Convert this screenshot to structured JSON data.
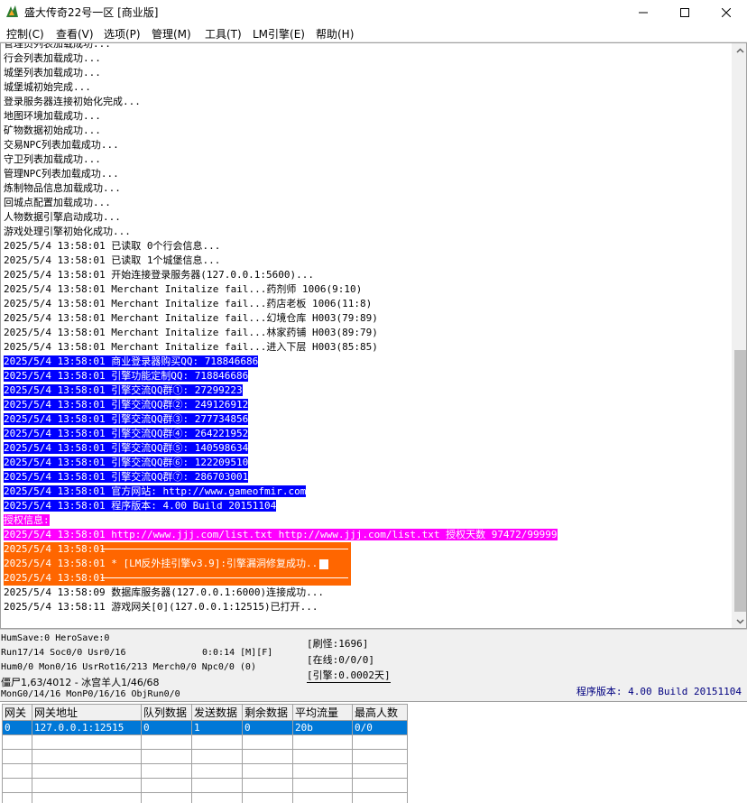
{
  "window": {
    "title": "盛大传奇22号一区 [商业版]",
    "controls": {
      "minimize": "minimize-icon",
      "maximize": "maximize-icon",
      "close": "close-icon"
    }
  },
  "menu": [
    "控制(C)",
    "查看(V)",
    "选项(P)",
    "管理(M)",
    "工具(T)",
    "LM引擎(E)",
    "帮助(H)"
  ],
  "log": [
    "管理员列表加载成功...",
    "行会列表加载成功...",
    "城堡列表加载成功...",
    "城堡城初始完成...",
    "登录服务器连接初始化完成...",
    "地图环境加载成功...",
    "矿物数据初始成功...",
    "交易NPC列表加载成功...",
    "守卫列表加载成功...",
    "管理NPC列表加载成功...",
    "炼制物品信息加载成功...",
    "回城点配置加载成功...",
    "人物数据引擎启动成功...",
    "游戏处理引擎初始化成功...",
    "2025/5/4 13:58:01 已读取 0个行会信息...",
    "2025/5/4 13:58:01 已读取 1个城堡信息...",
    "2025/5/4 13:58:01 开始连接登录服务器(127.0.0.1:5600)...",
    "2025/5/4 13:58:01 Merchant Initalize fail...药剂师 1006(9:10)",
    "2025/5/4 13:58:01 Merchant Initalize fail...药店老板 1006(11:8)",
    "2025/5/4 13:58:01 Merchant Initalize fail...幻境仓库 H003(79:89)",
    "2025/5/4 13:58:01 Merchant Initalize fail...林家药铺 H003(89:79)",
    "2025/5/4 13:58:01 Merchant Initalize fail...进入下层 H003(85:85)",
    "2025/5/4 13:58:01 商业登录器购买QQ: 718846686",
    "2025/5/4 13:58:01 引擎功能定制QQ: 718846686",
    "2025/5/4 13:58:01 引擎交流QQ群①: 27299223",
    "2025/5/4 13:58:01 引擎交流QQ群②: 249126912",
    "2025/5/4 13:58:01 引擎交流QQ群③: 277734856",
    "2025/5/4 13:58:01 引擎交流QQ群④: 264221952",
    "2025/5/4 13:58:01 引擎交流QQ群⑤: 140598634",
    "2025/5/4 13:58:01 引擎交流QQ群⑥: 122209510",
    "2025/5/4 13:58:01 引擎交流QQ群⑦: 286703001",
    "2025/5/4 13:58:01 官方网站: http://www.gameofmir.com",
    "2025/5/4 13:58:01 程序版本: 4.00 Build 20151104",
    "授权信息:",
    "2025/5/4 13:58:01 http://www.jjj.com/list.txt http://www.jjj.com/list.txt 授权天数 97472/99999",
    "2025/5/4 13:58:01",
    "2025/5/4 13:58:01 * [LM反外挂引擎v3.9]:引擎漏洞修复成功...",
    "2025/5/4 13:58:01",
    "2025/5/4 13:58:09 数据库服务器(127.0.0.1:6000)连接成功...",
    "2025/5/4 13:58:11 游戏网关[0](127.0.0.1:12515)已打开..."
  ],
  "status": {
    "line1": "HumSave:0 HeroSave:0",
    "line2": "Run17/14 Soc0/0 Usr0/16",
    "line2b": "0:0:14 [M][F]",
    "line3": "Hum0/0 Mon0/16 UsrRot16/213 Merch0/0 Npc0/0 (0)",
    "line4": "僵尸1,63/4012 - 冰宫羊人1/46/68",
    "line5": "MonG0/14/16 MonP0/16/16 ObjRun0/0",
    "refresh": "[刷怪:1696]",
    "online": "[在线:0/0/0]",
    "engine": "[引擎:0.0002天]",
    "version": "程序版本: 4.00 Build 20151104"
  },
  "gateway_table": {
    "columns": [
      "网关",
      "网关地址",
      "队列数据",
      "发送数据",
      "剩余数据",
      "平均流量",
      "最高人数"
    ],
    "rows": [
      [
        "0",
        "127.0.0.1:12515",
        "0",
        "1",
        "0",
        "20b",
        "0/0"
      ]
    ]
  }
}
